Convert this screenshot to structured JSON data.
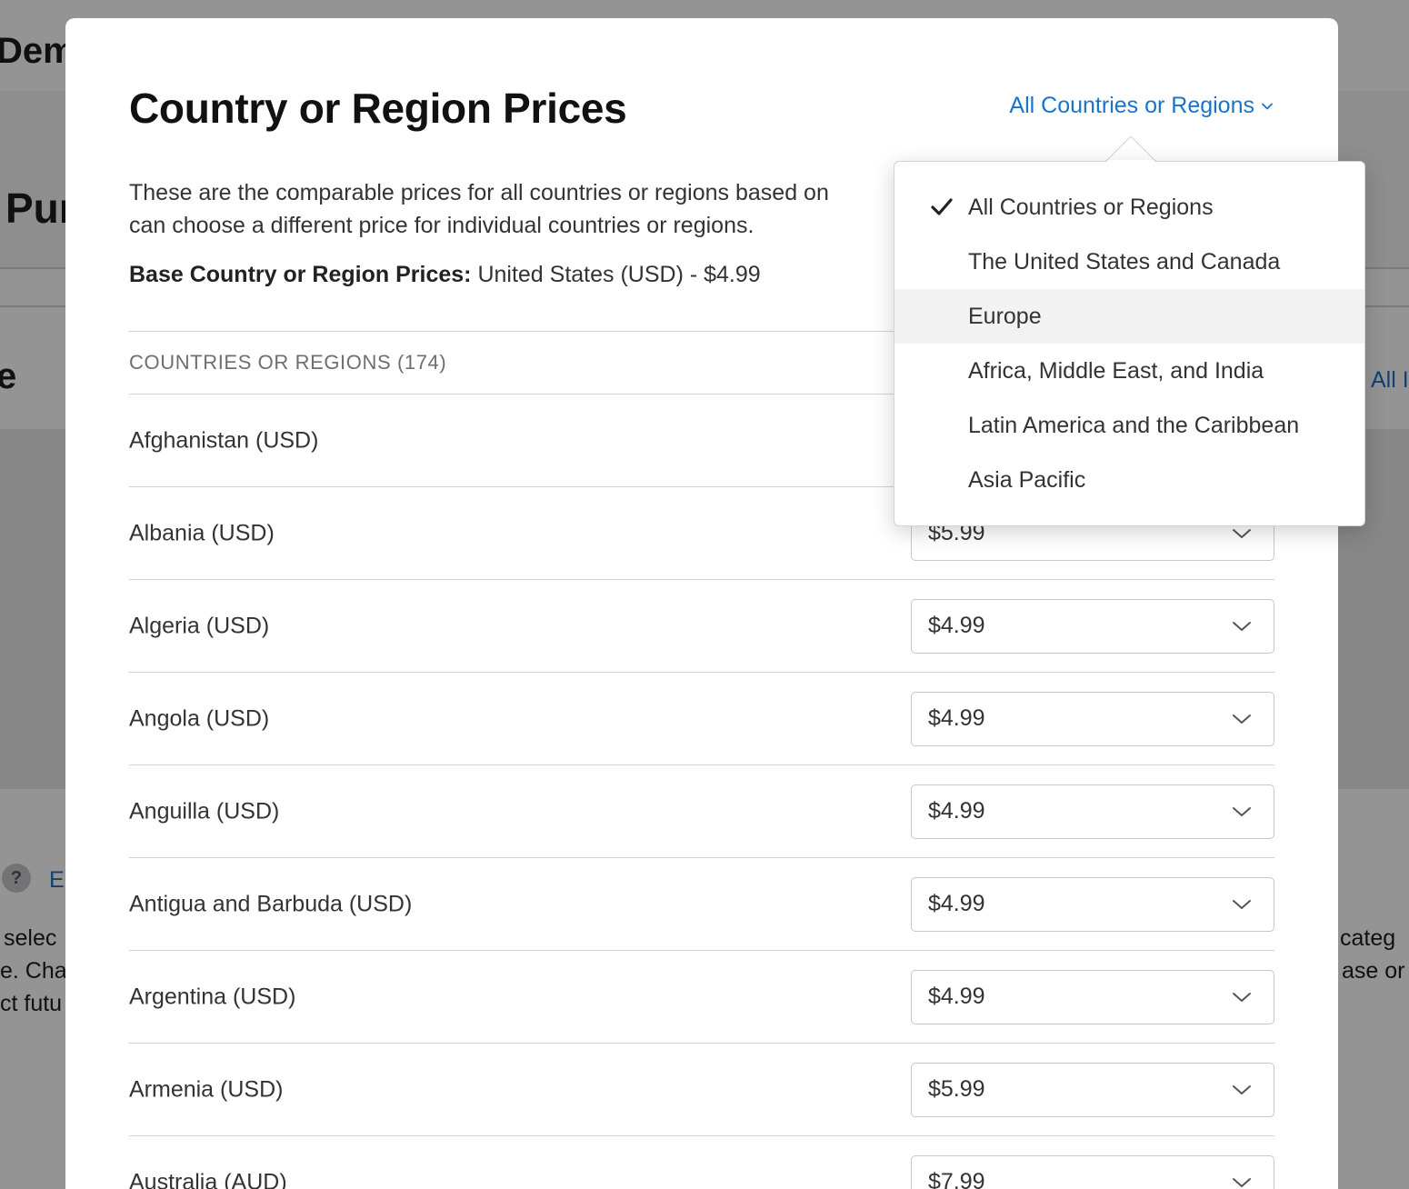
{
  "background": {
    "title_fragment": "Dem",
    "heading_fragment": "Pur",
    "section_fragment": "e",
    "right_link_fragment": "All I",
    "help_icon": "?",
    "help_link_fragment": "E",
    "left_text_lines": [
      "selec",
      "e. Char",
      "ct futu"
    ],
    "right_text_lines": [
      "categ",
      "ase or s"
    ]
  },
  "modal": {
    "title": "Country or Region Prices",
    "filter_label": "All Countries or Regions",
    "description_line1": "These are the comparable prices for all countries or regions based on",
    "description_line2": "can choose a different price for individual countries or regions.",
    "base_label": "Base Country or Region Prices:",
    "base_value": "United States (USD) - $4.99",
    "table_header": "COUNTRIES OR REGIONS (174)",
    "rows": [
      {
        "name": "Afghanistan (USD)",
        "price": ""
      },
      {
        "name": "Albania (USD)",
        "price": "$5.99"
      },
      {
        "name": "Algeria (USD)",
        "price": "$4.99"
      },
      {
        "name": "Angola (USD)",
        "price": "$4.99"
      },
      {
        "name": "Anguilla (USD)",
        "price": "$4.99"
      },
      {
        "name": "Antigua and Barbuda (USD)",
        "price": "$4.99"
      },
      {
        "name": "Argentina (USD)",
        "price": "$4.99"
      },
      {
        "name": "Armenia (USD)",
        "price": "$5.99"
      },
      {
        "name": "Australia (AUD)",
        "price": "$7.99"
      }
    ]
  },
  "dropdown": {
    "items": [
      {
        "label": "All Countries or Regions",
        "selected": true
      },
      {
        "label": "The United States and Canada",
        "selected": false
      },
      {
        "label": "Europe",
        "selected": false,
        "hover": true
      },
      {
        "label": "Africa, Middle East, and India",
        "selected": false
      },
      {
        "label": "Latin America and the Caribbean",
        "selected": false
      },
      {
        "label": "Asia Pacific",
        "selected": false
      }
    ]
  },
  "colors": {
    "link": "#1a73c8",
    "overlay": "rgba(0,0,0,0.42)",
    "divider": "#d2d2d7",
    "hover": "#f2f2f2"
  }
}
